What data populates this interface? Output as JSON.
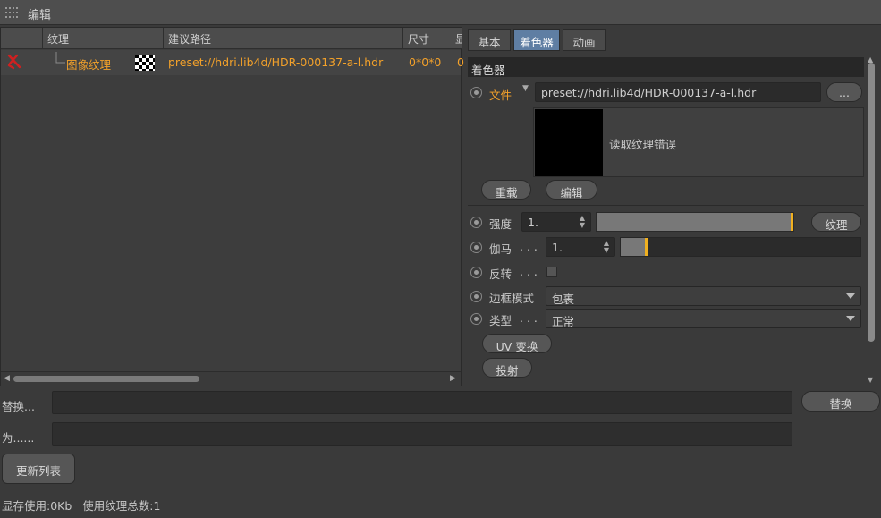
{
  "window": {
    "title": "编辑"
  },
  "table": {
    "headers": [
      "纹理",
      "",
      "建议路径",
      "尺寸",
      "显"
    ],
    "row": {
      "name": "图像纹理",
      "path": "preset://hdri.lib4d/HDR-000137-a-l.hdr",
      "size": "0*0*0",
      "extra": "0"
    }
  },
  "tabs": [
    "基本",
    "着色器",
    "动画"
  ],
  "shader": {
    "section_title": "着色器",
    "file_label": "文件",
    "file_path": "preset://hdri.lib4d/HDR-000137-a-l.hdr",
    "browse_label": "...",
    "preview_message": "读取纹理错误",
    "reload_label": "重载",
    "edit_label": "编辑",
    "intensity_label": "强度",
    "intensity_value": "1.",
    "intensity_level": 1.0,
    "texture_button": "纹理",
    "gamma_label": "伽马",
    "gamma_value": "1.",
    "invert_label": "反转",
    "invert_checked": false,
    "border_mode_label": "边框模式",
    "border_mode_value": "包裹",
    "type_label": "类型",
    "type_value": "正常",
    "uv_transform_label": "UV 变换",
    "projection_label": "投射",
    "dots": ". . ."
  },
  "bottom": {
    "replace_label": "替换...",
    "with_label": "为......",
    "replace_button": "替换",
    "refresh_button": "更新列表",
    "status_memory": "显存使用:0Kb",
    "status_count": "使用纹理总数:1"
  },
  "colors": {
    "accent": "#f3a12a",
    "tab_active": "#5f7ea3",
    "error_icon": "#d02020",
    "slider_marker": "#f0b020"
  }
}
